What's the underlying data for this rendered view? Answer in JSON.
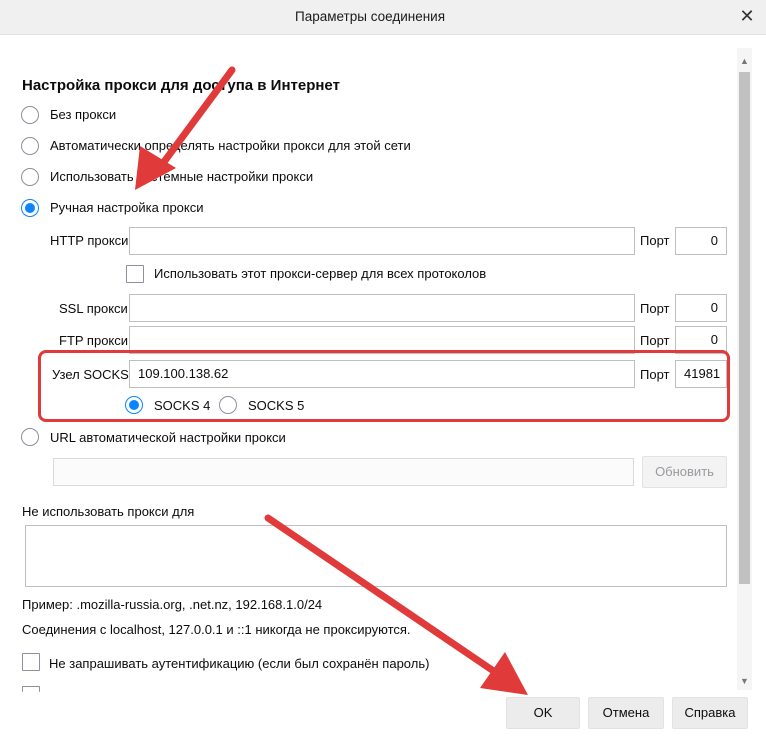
{
  "window": {
    "title": "Параметры соединения"
  },
  "proxy": {
    "section_title": "Настройка прокси для доступа в Интернет",
    "options": {
      "no_proxy": "Без прокси",
      "auto_detect": "Автоматически определять настройки прокси для этой сети",
      "system": "Использовать системные настройки прокси",
      "manual": "Ручная настройка прокси",
      "auto_url": "URL автоматической настройки прокси"
    },
    "selected": "manual",
    "http": {
      "label": "HTTP прокси",
      "host": "",
      "port_label": "Порт",
      "port": "0"
    },
    "share_all": "Использовать этот прокси-сервер для всех протоколов",
    "ssl": {
      "label": "SSL прокси",
      "host": "",
      "port_label": "Порт",
      "port": "0"
    },
    "ftp": {
      "label": "FTP прокси",
      "host": "",
      "port_label": "Порт",
      "port": "0"
    },
    "socks": {
      "label": "Узел SOCKS",
      "host": "109.100.138.62",
      "port_label": "Порт",
      "port": "41981",
      "v4": "SOCKS 4",
      "v5": "SOCKS 5",
      "version_selected": "SOCKS 4"
    },
    "auto_url_value": "",
    "reload_button": "Обновить"
  },
  "no_proxy_for": {
    "label": "Не использовать прокси для",
    "value": "",
    "example": "Пример: .mozilla-russia.org, .net.nz, 192.168.1.0/24",
    "localhost_note": "Соединения с localhost, 127.0.0.1 и ::1 никогда не проксируются."
  },
  "auth_checkbox": "Не запрашивать аутентификацию (если был сохранён пароль)",
  "buttons": {
    "ok": "OK",
    "cancel": "Отмена",
    "help": "Справка"
  },
  "colors": {
    "accent": "#0a84ff",
    "annotation": "#e03a3a"
  }
}
